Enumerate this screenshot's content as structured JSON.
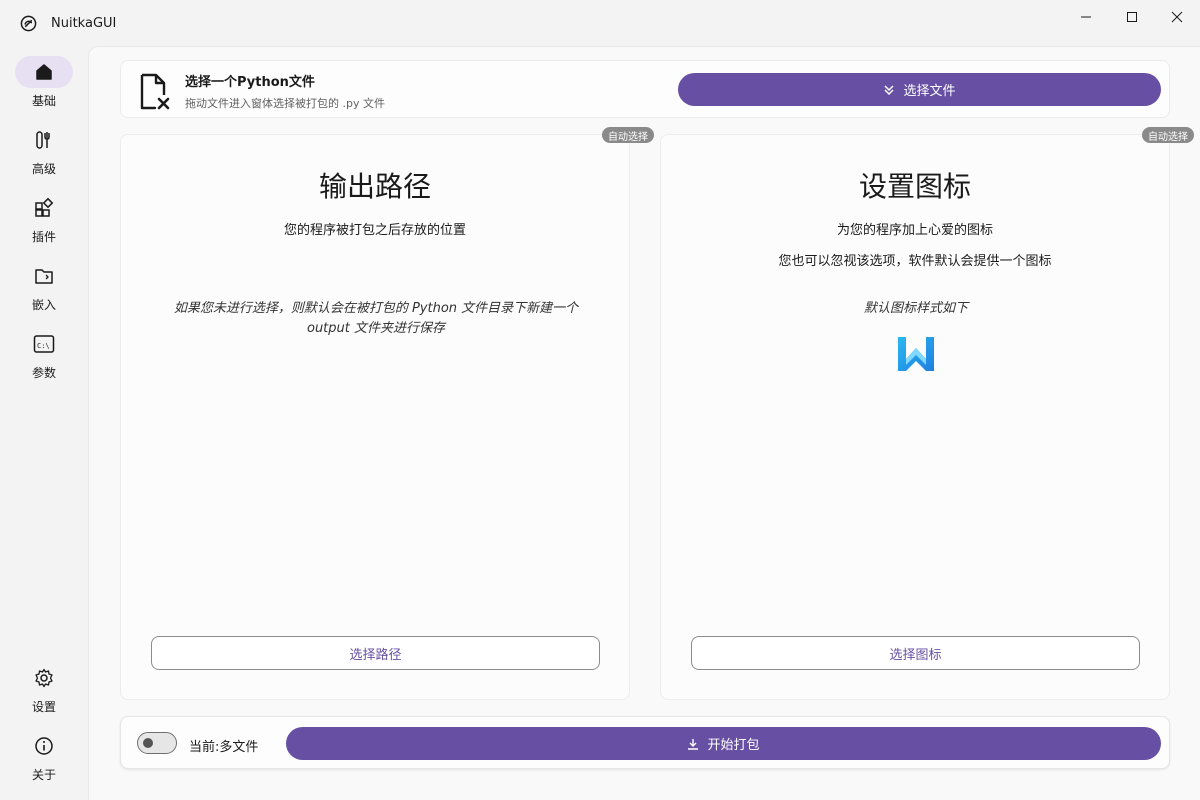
{
  "window": {
    "title": "NuitkaGUI",
    "logo_icon": "nuitka-logo-icon"
  },
  "sidebar": {
    "items": [
      {
        "label": "基础",
        "icon": "home-icon",
        "active": true
      },
      {
        "label": "高级",
        "icon": "tools-icon",
        "active": false
      },
      {
        "label": "插件",
        "icon": "apps-icon",
        "active": false
      },
      {
        "label": "嵌入",
        "icon": "folder-embed-icon",
        "active": false
      },
      {
        "label": "参数",
        "icon": "command-prompt-icon",
        "active": false
      },
      {
        "label": "设置",
        "icon": "gear-icon",
        "active": false
      },
      {
        "label": "关于",
        "icon": "info-icon",
        "active": false
      }
    ]
  },
  "file_card": {
    "title": "选择一个Python文件",
    "subtitle": "拖动文件进入窗体选择被打包的 .py 文件",
    "button_label": "选择文件"
  },
  "output_panel": {
    "badge": "自动选择",
    "title": "输出路径",
    "subtitle": "您的程序被打包之后存放的位置",
    "note": "如果您未进行选择，则默认会在被打包的 Python 文件目录下新建一个 output 文件夹进行保存",
    "button_label": "选择路径"
  },
  "icon_panel": {
    "badge": "自动选择",
    "title": "设置图标",
    "subtitle1": "为您的程序加上心爱的图标",
    "subtitle2": "您也可以忽视该选项，软件默认会提供一个图标",
    "note": "默认图标样式如下",
    "button_label": "选择图标"
  },
  "bottom_bar": {
    "mode_label": "当前:多文件",
    "start_label": "开始打包",
    "toggle_on": false
  },
  "colors": {
    "accent": "#6750a4",
    "active_nav_bg": "#e7e0f3",
    "badge_bg": "#8a8a8a"
  }
}
